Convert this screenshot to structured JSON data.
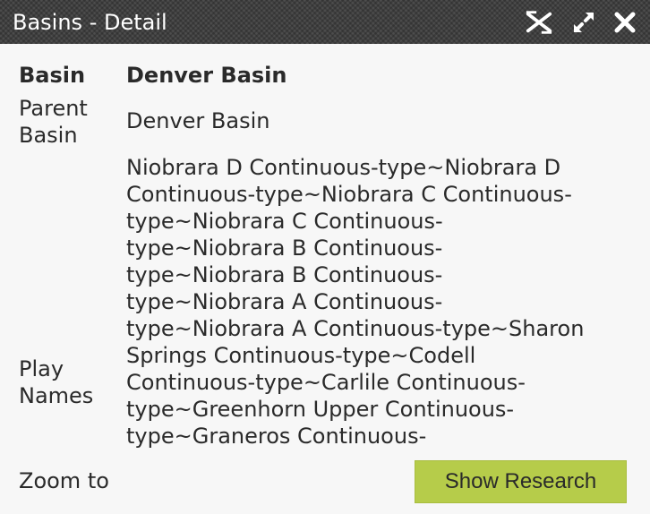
{
  "window": {
    "title": "Basins - Detail"
  },
  "titlebar_icons": [
    "undock-icon",
    "maximize-icon",
    "close-icon"
  ],
  "fields": {
    "basin_label": "Basin",
    "basin_value": "Denver Basin",
    "parent_basin_label_line1": "Parent",
    "parent_basin_label_line2": "Basin",
    "parent_basin_value": "Denver Basin",
    "play_names_label_line1": "Play",
    "play_names_label_line2": "Names",
    "play_names_lines": [
      "Niobrara D Continuous-type~Niobrara D",
      "Continuous-type~Niobrara C Continuous-",
      "type~Niobrara C Continuous-",
      "type~Niobrara B Continuous-",
      "type~Niobrara B Continuous-",
      "type~Niobrara A Continuous-",
      "type~Niobrara A Continuous-type~Sharon",
      "Springs Continuous-type~Codell",
      "Continuous-type~Carlile Continuous-",
      "type~Greenhorn Upper Continuous-",
      "type~Graneros Continuous-"
    ]
  },
  "actions": {
    "zoom_to_label": "Zoom to",
    "show_research_label": "Show Research"
  },
  "colors": {
    "titlebar": "#4d4d4d",
    "background": "#f7f7f7",
    "research_button": "#b6cc4a"
  }
}
